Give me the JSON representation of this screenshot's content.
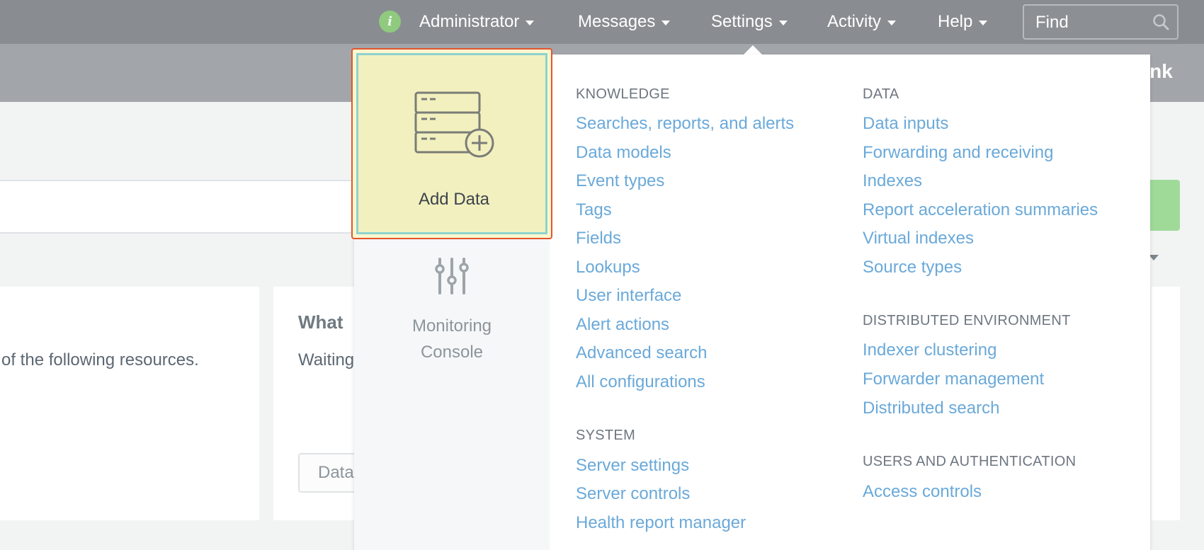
{
  "topnav": {
    "info_glyph": "i",
    "items": [
      {
        "label": "Administrator"
      },
      {
        "label": "Messages"
      },
      {
        "label": "Settings"
      },
      {
        "label": "Activity"
      },
      {
        "label": "Help"
      }
    ],
    "find_placeholder": "Find"
  },
  "appbar": {
    "brand_fragment": "unk"
  },
  "background": {
    "resources_text": "of the following resources.",
    "card_heading": "What",
    "card_sub": "Waiting",
    "card_button": "Data"
  },
  "dropdown": {
    "add_data_label": "Add Data",
    "monitoring_label_line1": "Monitoring",
    "monitoring_label_line2": "Console",
    "knowledge": {
      "heading": "KNOWLEDGE",
      "links": [
        "Searches, reports, and alerts",
        "Data models",
        "Event types",
        "Tags",
        "Fields",
        "Lookups",
        "User interface",
        "Alert actions",
        "Advanced search",
        "All configurations"
      ]
    },
    "system": {
      "heading": "SYSTEM",
      "links": [
        "Server settings",
        "Server controls",
        "Health report manager"
      ]
    },
    "data": {
      "heading": "DATA",
      "links": [
        "Data inputs",
        "Forwarding and receiving",
        "Indexes",
        "Report acceleration summaries",
        "Virtual indexes",
        "Source types"
      ]
    },
    "distributed": {
      "heading": "DISTRIBUTED ENVIRONMENT",
      "links": [
        "Indexer clustering",
        "Forwarder management",
        "Distributed search"
      ]
    },
    "users": {
      "heading": "USERS AND AUTHENTICATION",
      "links": [
        "Access controls"
      ]
    }
  },
  "colors": {
    "topbar": "#898d91",
    "link": "#6aa9d9",
    "highlight_border": "#e2552c",
    "tile_fill": "#f3f0bf"
  }
}
